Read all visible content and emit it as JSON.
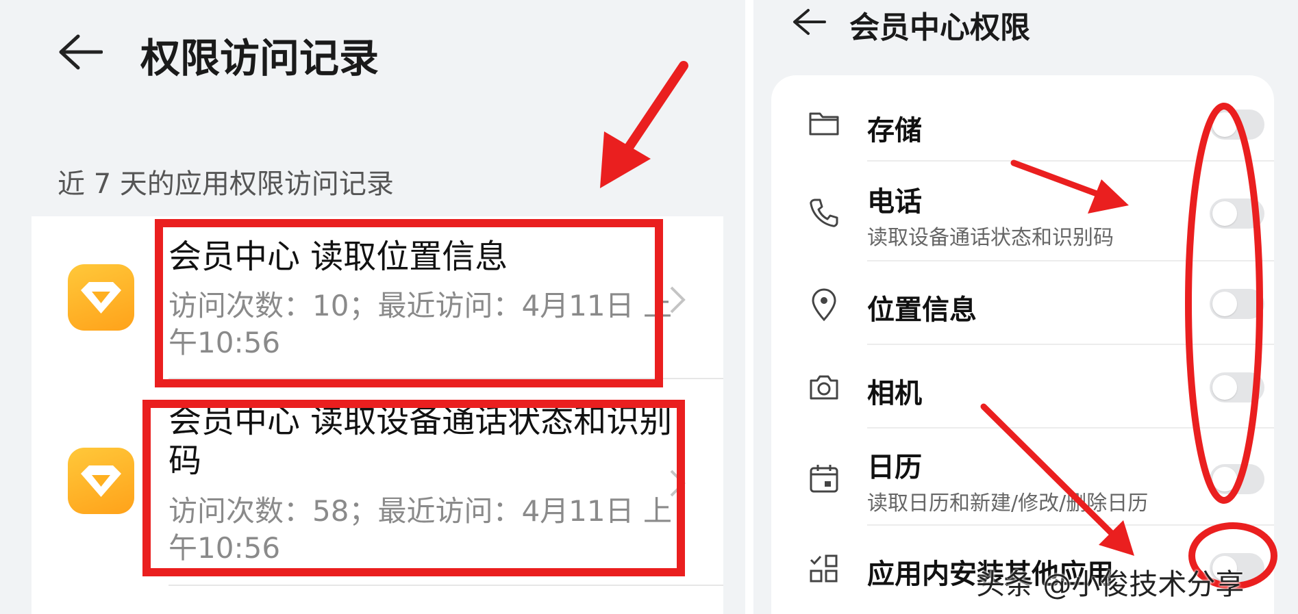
{
  "left_screen": {
    "title": "权限访问记录",
    "section_label": "近 7 天的应用权限访问记录",
    "records": [
      {
        "title": "会员中心 读取位置信息",
        "detail": "访问次数：10；最近访问：4月11日 上午10:56"
      },
      {
        "title": "会员中心 读取设备通话状态和识别码",
        "detail": "访问次数：58；最近访问：4月11日 上午10:56"
      }
    ]
  },
  "right_screen": {
    "title": "会员中心权限",
    "permissions": [
      {
        "label": "存储",
        "desc": "",
        "icon": "folder-icon",
        "enabled": false
      },
      {
        "label": "电话",
        "desc": "读取设备通话状态和识别码",
        "icon": "phone-icon",
        "enabled": false
      },
      {
        "label": "位置信息",
        "desc": "",
        "icon": "location-pin-icon",
        "enabled": false
      },
      {
        "label": "相机",
        "desc": "",
        "icon": "camera-icon",
        "enabled": false
      },
      {
        "label": "日历",
        "desc": "读取日历和新建/修改/删除日历",
        "icon": "calendar-icon",
        "enabled": false
      },
      {
        "label": "应用内安装其他应用",
        "desc": "",
        "icon": "apps-grid-icon",
        "enabled": false
      }
    ]
  },
  "watermark": "头条 @小俊技术分享",
  "colors": {
    "annotation_red": "#ea1f1f",
    "app_icon": "#ffb020",
    "toggle_off": "#e4e5e7",
    "background": "#f1f3f5"
  }
}
